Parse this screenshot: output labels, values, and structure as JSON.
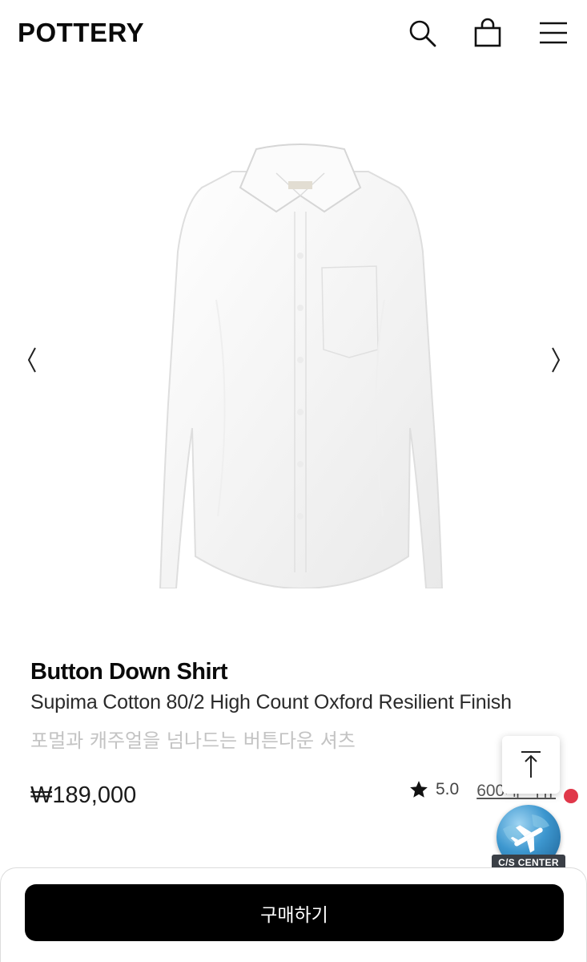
{
  "header": {
    "logo": "POTTERY",
    "icons": [
      "search-icon",
      "shopping-bag-icon",
      "hamburger-menu-icon"
    ]
  },
  "gallery": {
    "image": "white-button-down-shirt",
    "prev_icon": "chevron-left-icon",
    "next_icon": "chevron-right-icon"
  },
  "product": {
    "name": "Button Down Shirt",
    "subtitle": "Supima Cotton 80/2 High Count Oxford Resilient Finish",
    "description_ko": "포멀과 캐주얼을 넘나드는 버튼다운 셔츠",
    "price": "₩189,000",
    "rating": "5.0",
    "reviews": "600개 리뷰"
  },
  "floating": {
    "scroll_top_icon": "arrow-up-to-top-icon",
    "cs_center_label": "C/S CENTER",
    "notification_color": "#e0384a"
  },
  "cta": {
    "buy_label": "구매하기",
    "color": "#000000"
  }
}
